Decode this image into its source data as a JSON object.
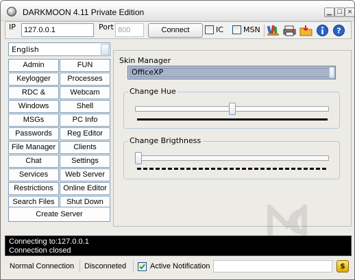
{
  "window": {
    "title": "DARKMOON 4.11 Private Edition",
    "minimize_glyph": "▁",
    "maximize_glyph": "☐",
    "close_glyph": "✕"
  },
  "connection": {
    "ip_label": "IP",
    "ip_value": "127.0.0.1",
    "port_label": "Port",
    "port_value": "800",
    "connect_label": "Connect",
    "ic_label": "IC",
    "msn_label": "MSN"
  },
  "toolbar_icons": [
    "brush-tools-icon",
    "printer-stack-icon",
    "folder-arrow-icon",
    "info-icon",
    "help-icon"
  ],
  "language": {
    "selected": "English"
  },
  "function_buttons": [
    [
      "Admin",
      "FUN"
    ],
    [
      "Keylogger",
      "Processes"
    ],
    [
      "RDC & Screen",
      "Webcam"
    ],
    [
      "Windows",
      "Shell"
    ],
    [
      "MSGs",
      "PC Info"
    ],
    [
      "Passwords",
      "Reg Editor"
    ],
    [
      "File Manager",
      "Clients"
    ],
    [
      "Chat",
      "Settings"
    ],
    [
      "Services",
      "Web Server"
    ],
    [
      "Restrictions",
      "Online Editor"
    ],
    [
      "Search Files",
      "Shut Down PC"
    ]
  ],
  "create_server_label": "Create Server",
  "skin": {
    "manager_label": "Skin Manager",
    "selected": "OfficeXP",
    "hue_label": "Change Hue",
    "hue_level": 0.5,
    "brightness_label": "Change Brigthness",
    "brightness_level": 0.0
  },
  "console_lines": [
    "Connecting to:127.0.0.1",
    "Connection closed"
  ],
  "status": {
    "connection_type": "Normal Connection",
    "state": "Disconneted",
    "notification_label": "Active Notification",
    "notification_checked": true,
    "dollar_glyph": "$"
  },
  "colors": {
    "window_bg": "#ecebe6",
    "console_bg": "#000000",
    "console_text": "#ffffff",
    "accent_blue": "#7f9db9"
  }
}
